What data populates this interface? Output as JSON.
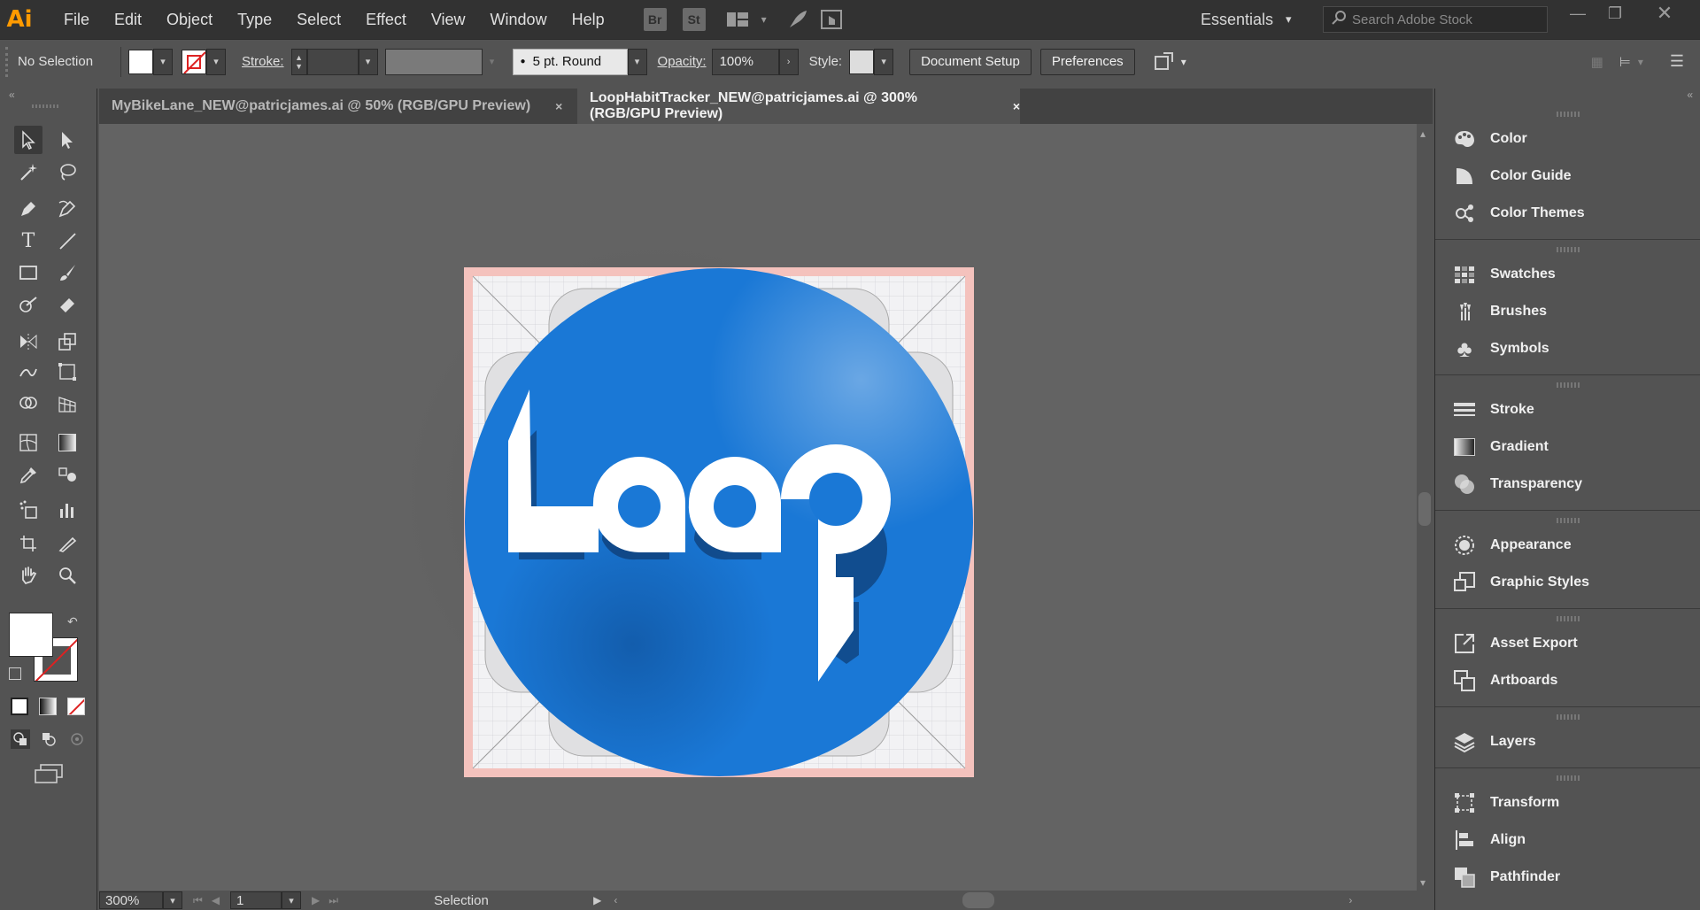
{
  "app": {
    "logo": "Ai"
  },
  "menu": [
    "File",
    "Edit",
    "Object",
    "Type",
    "Select",
    "Effect",
    "View",
    "Window",
    "Help"
  ],
  "header": {
    "bridge": "Br",
    "stock": "St",
    "workspace": "Essentials",
    "search_placeholder": "Search Adobe Stock"
  },
  "control": {
    "selection": "No Selection",
    "stroke_label": "Stroke:",
    "brush": "5 pt. Round",
    "opacity_label": "Opacity:",
    "opacity_value": "100%",
    "style_label": "Style:",
    "document_setup": "Document Setup",
    "preferences": "Preferences"
  },
  "tabs": [
    {
      "label": "MyBikeLane_NEW@patricjames.ai @ 50% (RGB/GPU Preview)",
      "close": "×"
    },
    {
      "label": "LoopHabitTracker_NEW@patricjames.ai @ 300% (RGB/GPU Preview)",
      "close": "×"
    }
  ],
  "artwork": {
    "text": "Loop",
    "circle_color": "#1a78d6"
  },
  "status": {
    "zoom": "300%",
    "artboard": "1",
    "tool": "Selection"
  },
  "panels": [
    [
      "Color",
      "Color Guide",
      "Color Themes"
    ],
    [
      "Swatches",
      "Brushes",
      "Symbols"
    ],
    [
      "Stroke",
      "Gradient",
      "Transparency"
    ],
    [
      "Appearance",
      "Graphic Styles"
    ],
    [
      "Asset Export",
      "Artboards"
    ],
    [
      "Layers"
    ],
    [
      "Transform",
      "Align",
      "Pathfinder"
    ]
  ]
}
